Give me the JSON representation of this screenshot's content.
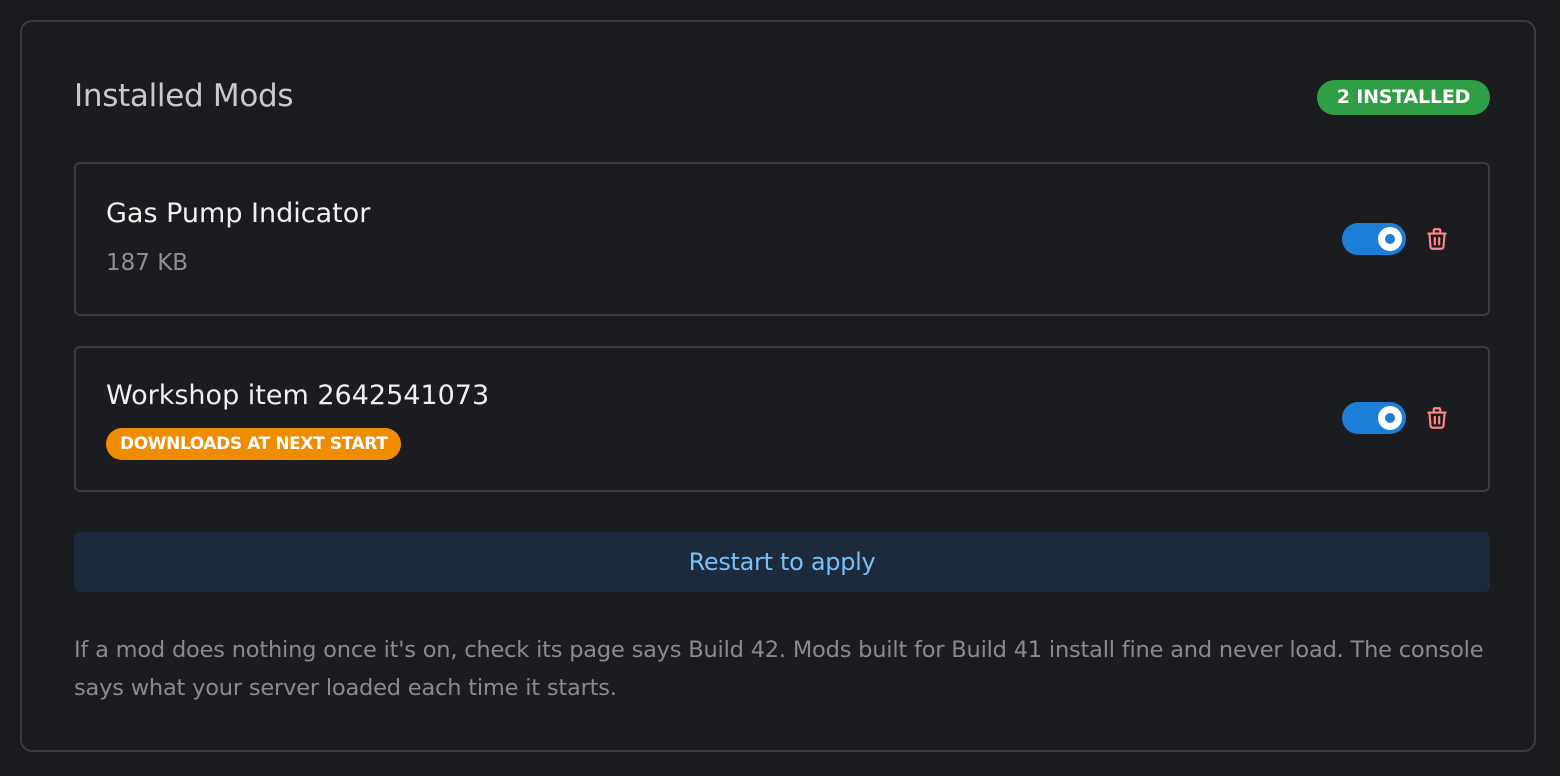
{
  "panel": {
    "title": "Installed Mods",
    "count_badge": "2 INSTALLED"
  },
  "mods": [
    {
      "name": "Gas Pump Indicator",
      "size": "187 KB",
      "enabled": true,
      "toggle_icon": "toggle-on-icon",
      "delete_icon": "trash-icon"
    },
    {
      "name": "Workshop item 2642541073",
      "status_badge": "DOWNLOADS AT NEXT START",
      "enabled": true,
      "toggle_icon": "toggle-on-icon",
      "delete_icon": "trash-icon"
    }
  ],
  "restart_button": "Restart to apply",
  "help_text": "If a mod does nothing once it's on, check its page says Build 42. Mods built for Build 41 install fine and never load. The console says what your server loaded each time it starts.",
  "colors": {
    "background": "#1a1b1e",
    "success_badge": "#2f9e44",
    "pending_badge": "#f08c00",
    "toggle_on": "#1c7ed6",
    "delete": "#ff8787",
    "restart_text": "#74c0fc"
  }
}
